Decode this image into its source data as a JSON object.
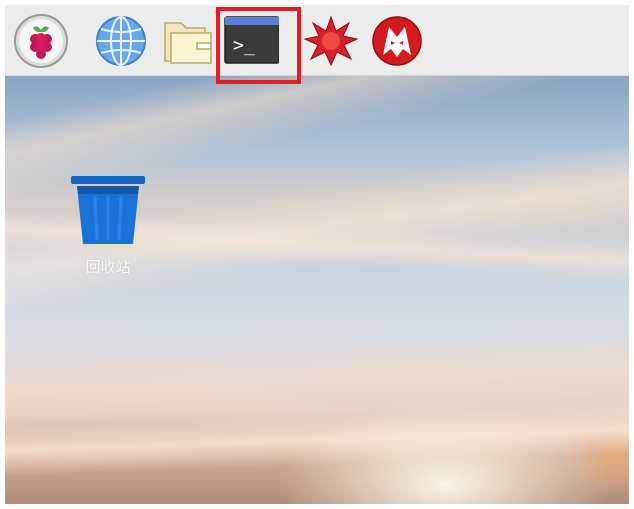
{
  "taskbar": {
    "launchers": [
      {
        "id": "raspberry-menu",
        "icon": "raspberry-icon"
      },
      {
        "id": "web-browser",
        "icon": "globe-icon"
      },
      {
        "id": "file-manager",
        "icon": "folder-icon"
      },
      {
        "id": "terminal",
        "icon": "terminal-icon",
        "prompt": ">_",
        "highlighted": true
      },
      {
        "id": "mathematica",
        "icon": "mathematica-spikey-icon"
      },
      {
        "id": "wolfram",
        "icon": "wolfram-wolf-icon"
      }
    ]
  },
  "desktop": {
    "trash": {
      "icon": "trash-can-icon",
      "label": "回收站"
    }
  },
  "colors": {
    "highlight": "#e11d26",
    "taskbar": "#ececec",
    "trash_blue": "#1565c0",
    "terminal_bar": "#5b7fd6"
  }
}
